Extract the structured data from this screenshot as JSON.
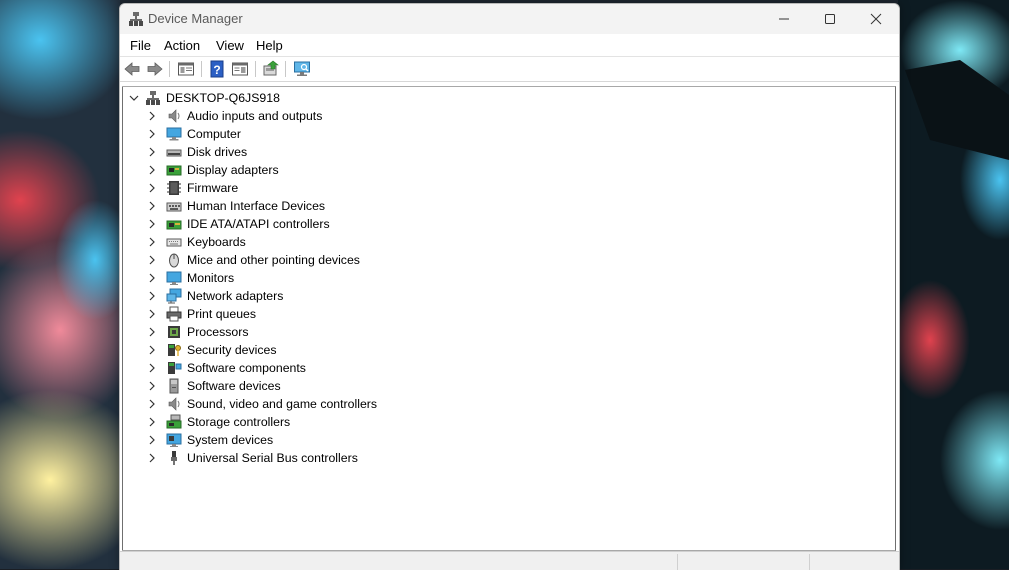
{
  "window": {
    "title": "Device Manager"
  },
  "menu": [
    "File",
    "Action",
    "View",
    "Help"
  ],
  "toolbar": {
    "buttons": [
      "back-icon",
      "forward-icon",
      "properties-view-icon",
      "help-icon",
      "show-hidden-icon",
      "update-driver-icon",
      "scan-hardware-icon"
    ]
  },
  "tree": {
    "root": "DESKTOP-Q6JS918",
    "items": [
      {
        "label": "Audio inputs and outputs",
        "icon": "speaker-icon"
      },
      {
        "label": "Computer",
        "icon": "computer-icon"
      },
      {
        "label": "Disk drives",
        "icon": "disk-drive-icon"
      },
      {
        "label": "Display adapters",
        "icon": "display-adapter-icon"
      },
      {
        "label": "Firmware",
        "icon": "firmware-icon"
      },
      {
        "label": "Human Interface Devices",
        "icon": "hid-icon"
      },
      {
        "label": "IDE ATA/ATAPI controllers",
        "icon": "ide-controller-icon"
      },
      {
        "label": "Keyboards",
        "icon": "keyboard-icon"
      },
      {
        "label": "Mice and other pointing devices",
        "icon": "mouse-icon"
      },
      {
        "label": "Monitors",
        "icon": "monitor-icon"
      },
      {
        "label": "Network adapters",
        "icon": "network-adapter-icon"
      },
      {
        "label": "Print queues",
        "icon": "printer-icon"
      },
      {
        "label": "Processors",
        "icon": "processor-icon"
      },
      {
        "label": "Security devices",
        "icon": "security-device-icon"
      },
      {
        "label": "Software components",
        "icon": "software-component-icon"
      },
      {
        "label": "Software devices",
        "icon": "software-device-icon"
      },
      {
        "label": "Sound, video and game controllers",
        "icon": "sound-controller-icon"
      },
      {
        "label": "Storage controllers",
        "icon": "storage-controller-icon"
      },
      {
        "label": "System devices",
        "icon": "system-device-icon"
      },
      {
        "label": "Universal Serial Bus controllers",
        "icon": "usb-icon"
      }
    ]
  }
}
